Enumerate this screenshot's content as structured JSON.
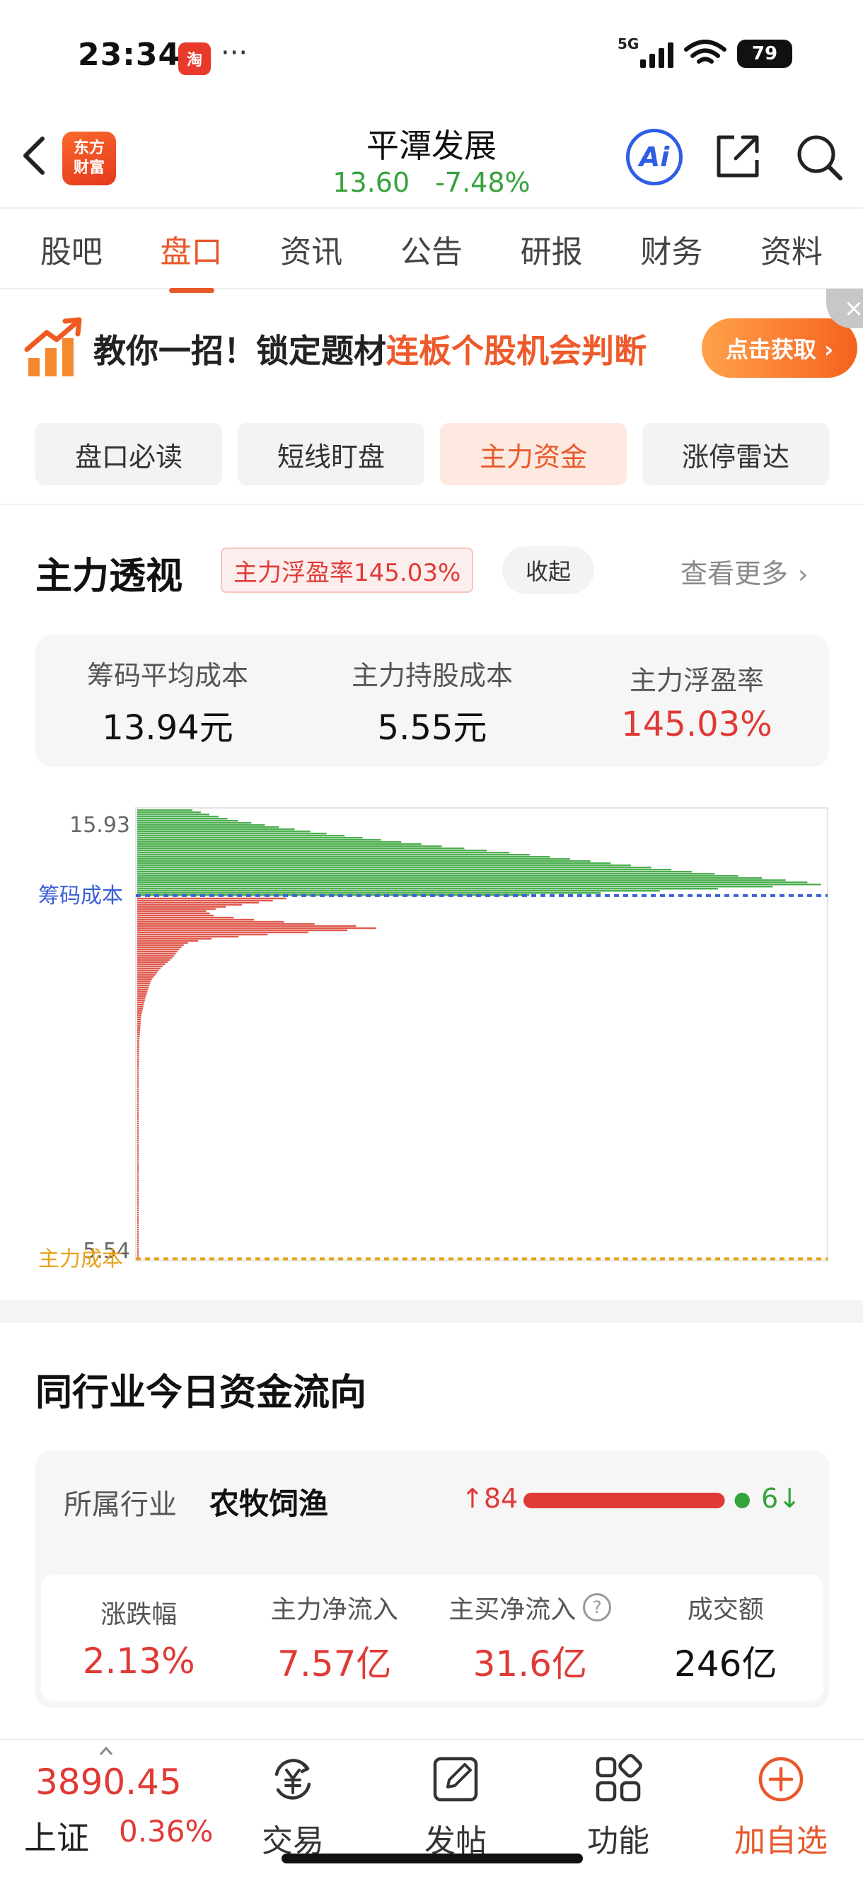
{
  "status_bar": {
    "time": "23:34",
    "app_icon_text": "淘",
    "dots": "···",
    "network": "5G",
    "battery": "79"
  },
  "header": {
    "logo_line1": "东方",
    "logo_line2": "财富",
    "stock_name": "平潭发展",
    "price": "13.60",
    "change_pct": "-7.48%",
    "ai_label": "Ai"
  },
  "tabs": [
    "股吧",
    "盘口",
    "资讯",
    "公告",
    "研报",
    "财务",
    "资料"
  ],
  "active_tab": "盘口",
  "banner": {
    "text_plain": "教你一招！锁定题材",
    "text_highlight": "连板个股机会判断",
    "button_label": "点击获取 ›",
    "close_glyph": "×"
  },
  "subtabs": [
    "盘口必读",
    "短线盯盘",
    "主力资金",
    "涨停雷达"
  ],
  "active_subtab": "主力资金",
  "section_main": {
    "title": "主力透视",
    "badge": "主力浮盈率145.03%",
    "collapse_label": "收起",
    "more_label": "查看更多",
    "stats": [
      {
        "label": "筹码平均成本",
        "value": "13.94元"
      },
      {
        "label": "主力持股成本",
        "value": "5.55元"
      },
      {
        "label": "主力浮盈率",
        "value": "145.03%"
      }
    ]
  },
  "chart_data": {
    "type": "bar",
    "orientation": "horizontal",
    "title": "",
    "y_top_label": "15.93",
    "y_bottom_label": "5.54",
    "ylim": [
      5.54,
      15.93
    ],
    "reference_lines": [
      {
        "label": "筹码成本",
        "value": 13.94,
        "color": "#3b5fd9"
      },
      {
        "label": "主力成本",
        "value": 5.55,
        "color": "#e8a21a"
      }
    ],
    "series": [
      {
        "color": "#4caf50",
        "price_range": [
          13.94,
          15.93
        ]
      },
      {
        "color": "#e05a4e",
        "price_range": [
          5.54,
          13.94
        ]
      }
    ],
    "green_profile": [
      [
        15.93,
        0.08
      ],
      [
        15.85,
        0.1
      ],
      [
        15.7,
        0.14
      ],
      [
        15.55,
        0.2
      ],
      [
        15.4,
        0.27
      ],
      [
        15.25,
        0.35
      ],
      [
        15.1,
        0.44
      ],
      [
        14.95,
        0.54
      ],
      [
        14.8,
        0.63
      ],
      [
        14.65,
        0.72
      ],
      [
        14.5,
        0.81
      ],
      [
        14.4,
        0.88
      ],
      [
        14.3,
        0.95
      ],
      [
        14.22,
        1.0
      ],
      [
        14.15,
        0.9
      ],
      [
        14.08,
        0.78
      ],
      [
        14.0,
        0.64
      ],
      [
        13.94,
        0.5
      ]
    ],
    "red_profile": [
      [
        13.9,
        0.22
      ],
      [
        13.8,
        0.18
      ],
      [
        13.7,
        0.13
      ],
      [
        13.6,
        0.1
      ],
      [
        13.5,
        0.11
      ],
      [
        13.4,
        0.17
      ],
      [
        13.3,
        0.26
      ],
      [
        13.22,
        0.36
      ],
      [
        13.15,
        0.3
      ],
      [
        13.05,
        0.18
      ],
      [
        12.95,
        0.1
      ],
      [
        12.85,
        0.07
      ],
      [
        12.7,
        0.06
      ],
      [
        12.5,
        0.05
      ],
      [
        12.3,
        0.035
      ],
      [
        12.0,
        0.02
      ],
      [
        11.6,
        0.012
      ],
      [
        11.2,
        0.006
      ],
      [
        10.6,
        0.003
      ],
      [
        9.8,
        0.002
      ],
      [
        8.8,
        0.001
      ],
      [
        7.8,
        0.0005
      ],
      [
        6.8,
        0.0003
      ],
      [
        5.8,
        0.0002
      ],
      [
        5.54,
        0.0
      ]
    ]
  },
  "section_industry": {
    "title": "同行业今日资金流向",
    "industry_label": "所属行业",
    "industry_name": "农牧饲渔",
    "up_count": "84",
    "down_count": "6",
    "up_fraction": 0.93,
    "stats": [
      {
        "label": "涨跌幅",
        "value": "2.13%"
      },
      {
        "label": "主力净流入",
        "value": "7.57亿"
      },
      {
        "label": "主买净流入",
        "value": "31.6亿"
      },
      {
        "label": "成交额",
        "value": "246亿"
      }
    ],
    "help_glyph": "?"
  },
  "bottom_bar": {
    "index_value": "3890.45",
    "index_name": "上证",
    "index_change": "0.36%",
    "nav": [
      "交易",
      "发帖",
      "功能",
      "加自选"
    ]
  },
  "colors": {
    "accent": "#e8582a",
    "up": "#e03a36",
    "down": "#35a33b"
  }
}
